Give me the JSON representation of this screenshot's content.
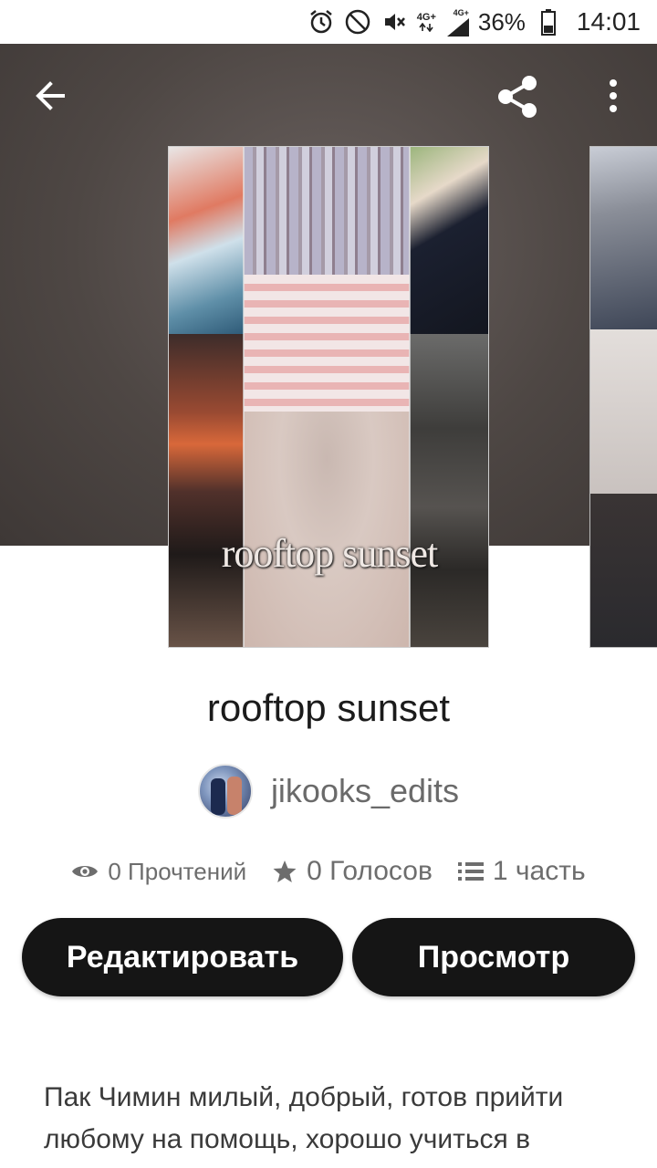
{
  "status_bar": {
    "network_label_1": "4G+",
    "network_label_2": "4G+",
    "battery": "36%",
    "time": "14:01",
    "icons": [
      "alarm-icon",
      "do-not-disturb-icon",
      "vibrate-off-icon",
      "signal-icon",
      "battery-icon"
    ]
  },
  "header": {
    "back_icon": "arrow-left-icon",
    "share_icon": "share-icon",
    "more_icon": "more-vertical-icon"
  },
  "cover": {
    "title_text": "rooftop sunset"
  },
  "story": {
    "title": "rooftop sunset",
    "author": "jikooks_edits"
  },
  "stats": {
    "reads": "0 Прочтений",
    "votes": "0 Голосов",
    "parts": "1 часть",
    "reads_icon": "eye-icon",
    "votes_icon": "star-icon",
    "parts_icon": "list-icon"
  },
  "actions": {
    "edit_label": "Редактировать",
    "preview_label": "Просмотр"
  },
  "description": "Пак Чимин милый, добрый, готов прийти любому на помощь, хорошо учиться в",
  "colors": {
    "button_bg": "#151515",
    "header_bg": "#4e4744"
  }
}
